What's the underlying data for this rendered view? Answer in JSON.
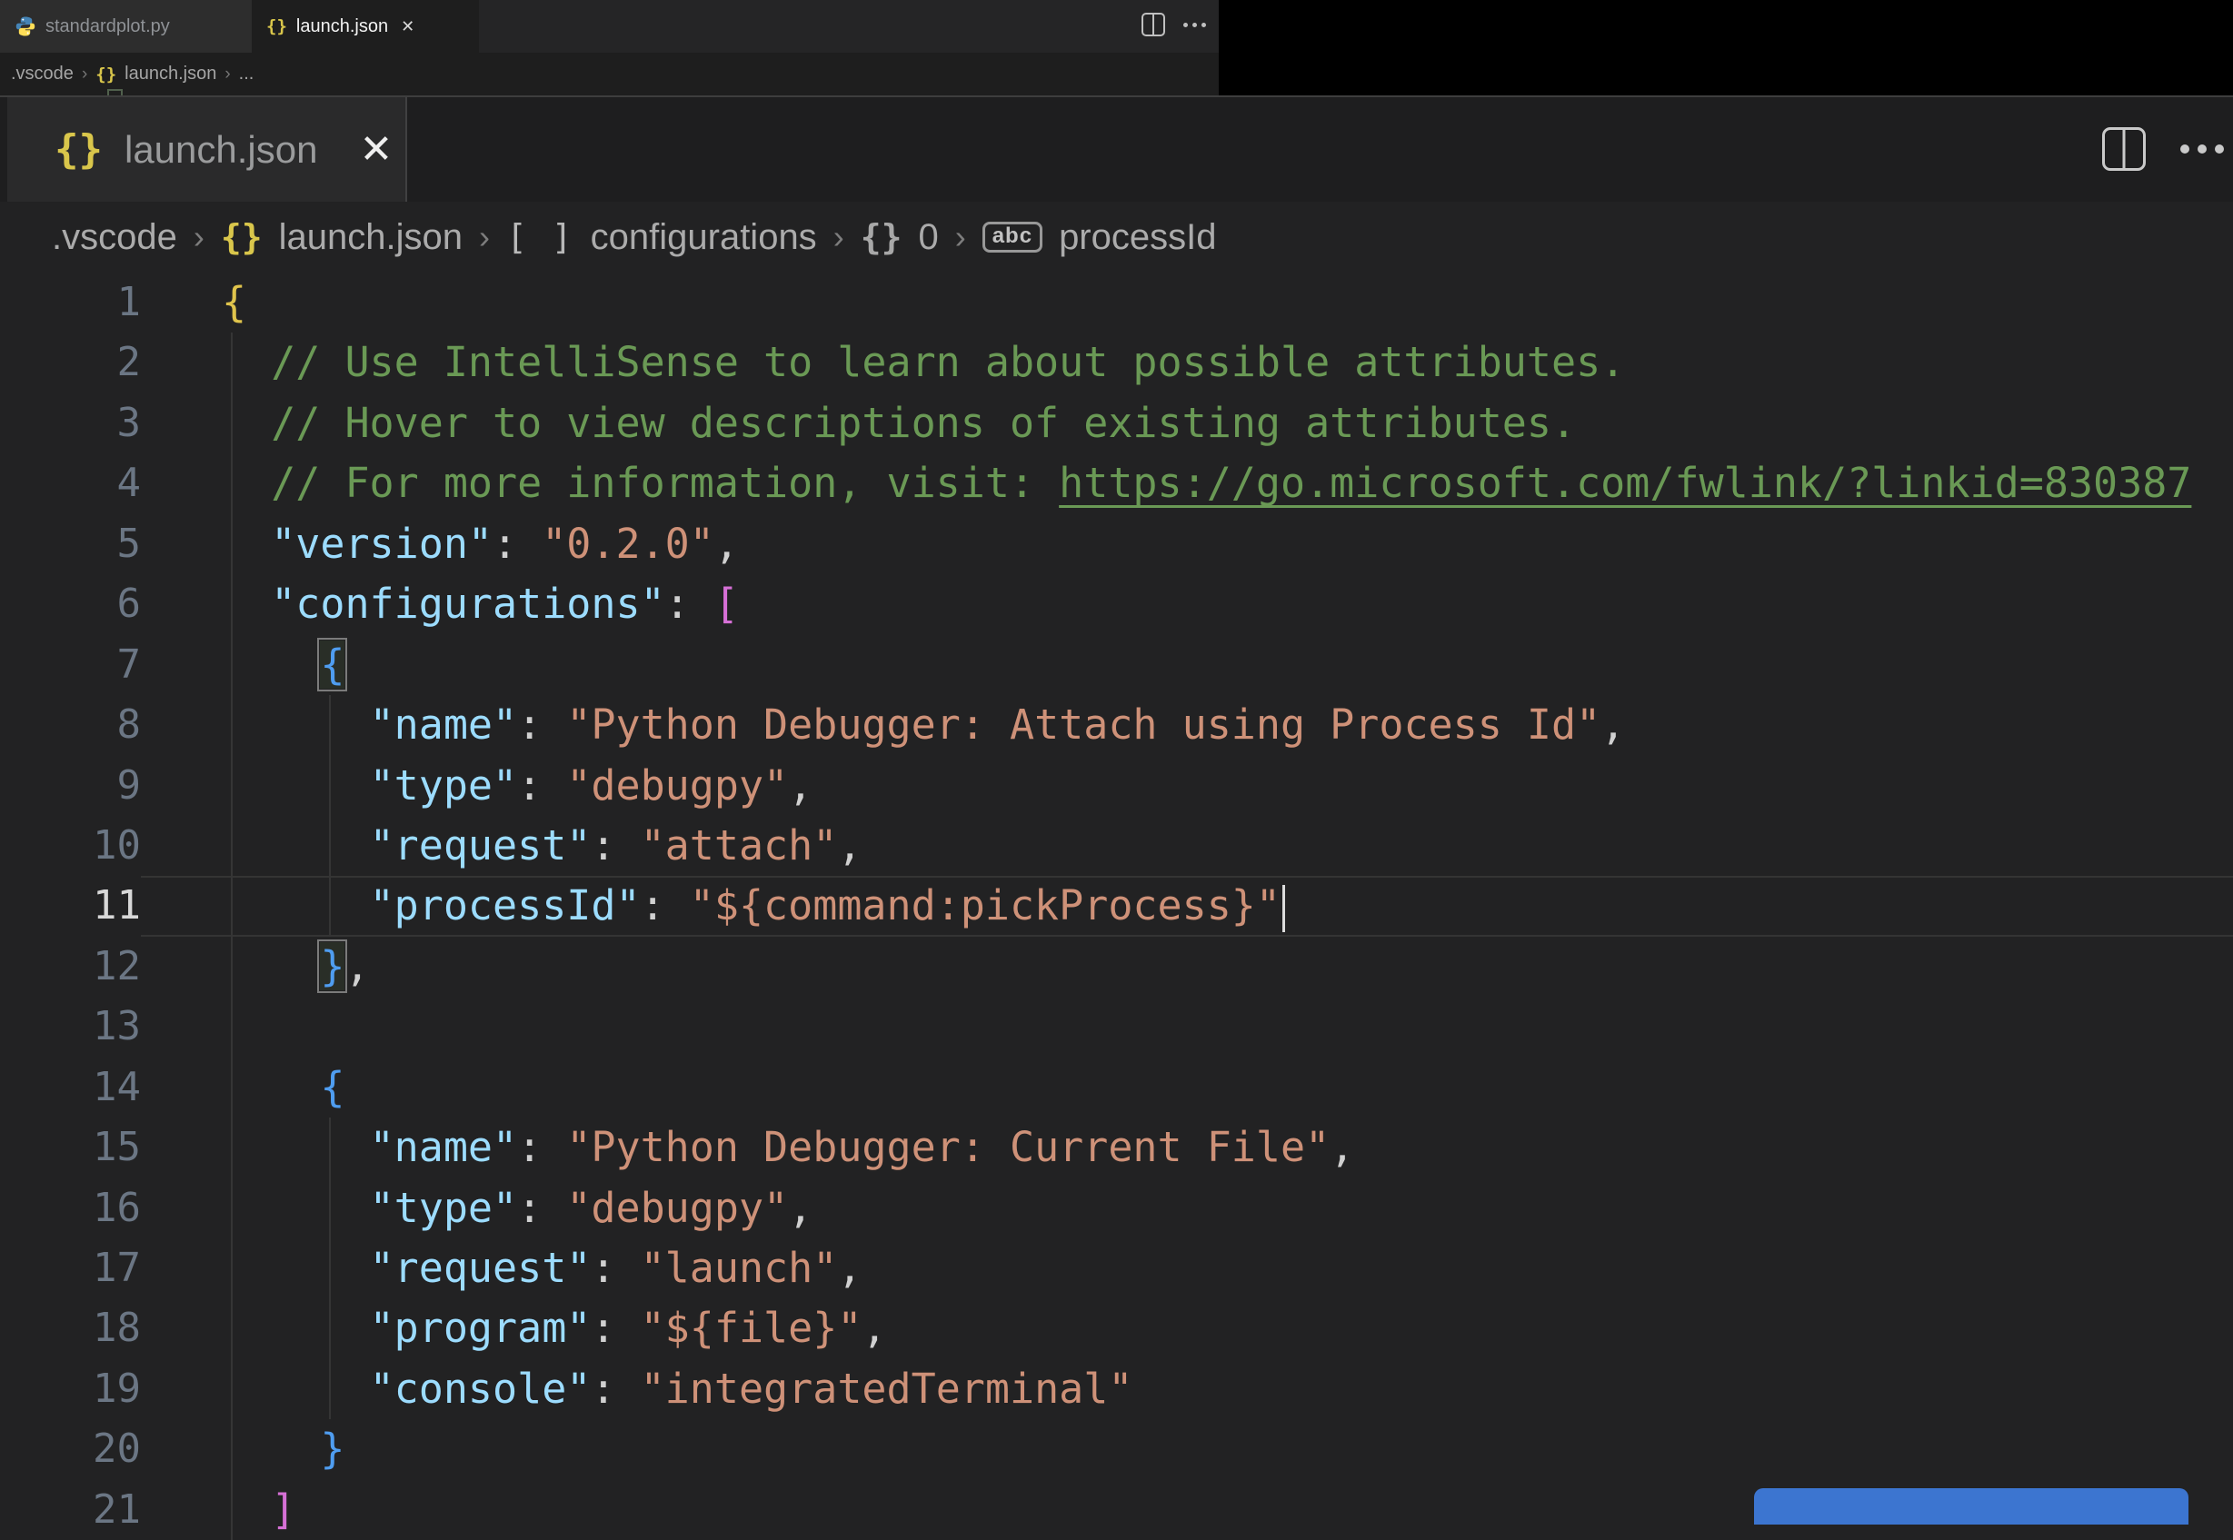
{
  "colors": {
    "accent_blue_button": "#3c75d0",
    "json_icon_yellow": "#d9c64b",
    "bracket_gold": "#e0c44c",
    "bracket_pink": "#d670d6",
    "bracket_blue": "#4f9df0",
    "property_blue": "#9cdcfe",
    "string_orange": "#ce9178",
    "comment_green": "#6a9955"
  },
  "small_bar": {
    "tabs": [
      {
        "label": "standardplot.py",
        "icon": "python"
      },
      {
        "label": "launch.json",
        "icon": "json-braces",
        "close_label": "✕"
      }
    ],
    "braces_glyph": "{}",
    "breadcrumb": {
      "item1": ".vscode",
      "item2": "launch.json",
      "item3": "...",
      "separator": "›"
    }
  },
  "editor": {
    "tab": {
      "label": "launch.json",
      "close_label": "✕",
      "braces_glyph": "{}"
    },
    "breadcrumb": {
      "separator": "›",
      "item1": ".vscode",
      "item2": "launch.json",
      "item3": "configurations",
      "item4": "0",
      "item5": "processId",
      "array_icon_glyph": "[ ]",
      "object_icon_glyph": "{}",
      "string_icon_glyph": "abc"
    },
    "active_line": 11,
    "lines": [
      {
        "n": 1,
        "guides": [],
        "segs": [
          [
            "b1",
            "{"
          ]
        ]
      },
      {
        "n": 2,
        "guides": [
          0
        ],
        "segs": [
          [
            "ws",
            "  "
          ],
          [
            "com",
            "// Use IntelliSense to learn about possible attributes."
          ]
        ]
      },
      {
        "n": 3,
        "guides": [
          0
        ],
        "segs": [
          [
            "ws",
            "  "
          ],
          [
            "com",
            "// Hover to view descriptions of existing attributes."
          ]
        ]
      },
      {
        "n": 4,
        "guides": [
          0
        ],
        "segs": [
          [
            "ws",
            "  "
          ],
          [
            "com",
            "// For more information, visit: "
          ],
          [
            "link",
            "https://go.microsoft.com/fwlink/?linkid=830387"
          ]
        ]
      },
      {
        "n": 5,
        "guides": [
          0
        ],
        "segs": [
          [
            "ws",
            "  "
          ],
          [
            "prop",
            "\"version\""
          ],
          [
            "pun",
            ": "
          ],
          [
            "str",
            "\"0.2.0\""
          ],
          [
            "pun",
            ","
          ]
        ]
      },
      {
        "n": 6,
        "guides": [
          0
        ],
        "segs": [
          [
            "ws",
            "  "
          ],
          [
            "prop",
            "\"configurations\""
          ],
          [
            "pun",
            ": "
          ],
          [
            "b2",
            "["
          ]
        ]
      },
      {
        "n": 7,
        "guides": [
          0
        ],
        "segs": [
          [
            "ws",
            "    "
          ],
          [
            "b3 bm",
            "{"
          ]
        ]
      },
      {
        "n": 8,
        "guides": [
          0,
          4
        ],
        "segs": [
          [
            "ws",
            "      "
          ],
          [
            "prop",
            "\"name\""
          ],
          [
            "pun",
            ": "
          ],
          [
            "str",
            "\"Python Debugger: Attach using Process Id\""
          ],
          [
            "pun",
            ","
          ]
        ]
      },
      {
        "n": 9,
        "guides": [
          0,
          4
        ],
        "segs": [
          [
            "ws",
            "      "
          ],
          [
            "prop",
            "\"type\""
          ],
          [
            "pun",
            ": "
          ],
          [
            "str",
            "\"debugpy\""
          ],
          [
            "pun",
            ","
          ]
        ]
      },
      {
        "n": 10,
        "guides": [
          0,
          4
        ],
        "segs": [
          [
            "ws",
            "      "
          ],
          [
            "prop",
            "\"request\""
          ],
          [
            "pun",
            ": "
          ],
          [
            "str",
            "\"attach\""
          ],
          [
            "pun",
            ","
          ]
        ]
      },
      {
        "n": 11,
        "guides": [
          0,
          4
        ],
        "segs": [
          [
            "ws",
            "      "
          ],
          [
            "prop",
            "\"processId\""
          ],
          [
            "pun",
            ": "
          ],
          [
            "str",
            "\"${command:pickProcess}\""
          ],
          [
            "cursor",
            ""
          ]
        ]
      },
      {
        "n": 12,
        "guides": [
          0
        ],
        "segs": [
          [
            "ws",
            "    "
          ],
          [
            "b3 bm",
            "}"
          ],
          [
            "pun",
            ","
          ]
        ]
      },
      {
        "n": 13,
        "guides": [
          0
        ],
        "segs": []
      },
      {
        "n": 14,
        "guides": [
          0
        ],
        "segs": [
          [
            "ws",
            "    "
          ],
          [
            "b3",
            "{"
          ]
        ]
      },
      {
        "n": 15,
        "guides": [
          0,
          4
        ],
        "segs": [
          [
            "ws",
            "      "
          ],
          [
            "prop",
            "\"name\""
          ],
          [
            "pun",
            ": "
          ],
          [
            "str",
            "\"Python Debugger: Current File\""
          ],
          [
            "pun",
            ","
          ]
        ]
      },
      {
        "n": 16,
        "guides": [
          0,
          4
        ],
        "segs": [
          [
            "ws",
            "      "
          ],
          [
            "prop",
            "\"type\""
          ],
          [
            "pun",
            ": "
          ],
          [
            "str",
            "\"debugpy\""
          ],
          [
            "pun",
            ","
          ]
        ]
      },
      {
        "n": 17,
        "guides": [
          0,
          4
        ],
        "segs": [
          [
            "ws",
            "      "
          ],
          [
            "prop",
            "\"request\""
          ],
          [
            "pun",
            ": "
          ],
          [
            "str",
            "\"launch\""
          ],
          [
            "pun",
            ","
          ]
        ]
      },
      {
        "n": 18,
        "guides": [
          0,
          4
        ],
        "segs": [
          [
            "ws",
            "      "
          ],
          [
            "prop",
            "\"program\""
          ],
          [
            "pun",
            ": "
          ],
          [
            "str",
            "\"${file}\""
          ],
          [
            "pun",
            ","
          ]
        ]
      },
      {
        "n": 19,
        "guides": [
          0,
          4
        ],
        "segs": [
          [
            "ws",
            "      "
          ],
          [
            "prop",
            "\"console\""
          ],
          [
            "pun",
            ": "
          ],
          [
            "str",
            "\"integratedTerminal\""
          ]
        ]
      },
      {
        "n": 20,
        "guides": [
          0
        ],
        "segs": [
          [
            "ws",
            "    "
          ],
          [
            "b3",
            "}"
          ]
        ]
      },
      {
        "n": 21,
        "guides": [
          0
        ],
        "segs": [
          [
            "ws",
            "  "
          ],
          [
            "b2",
            "]"
          ]
        ]
      }
    ]
  }
}
